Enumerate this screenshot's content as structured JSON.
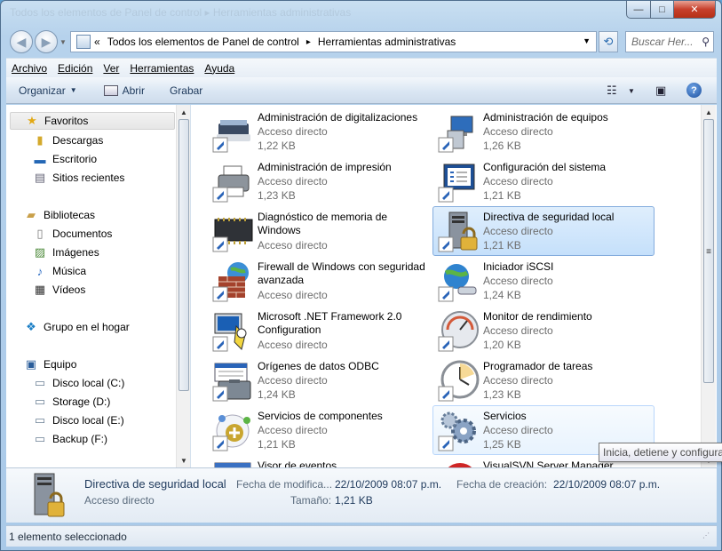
{
  "window": {
    "title": "Todos los elementos de Panel de control ▸ Herramientas administrativas",
    "controls": {
      "minimize": "—",
      "maximize": "□",
      "close": "✕"
    }
  },
  "address": {
    "overflow": "«",
    "crumbs": [
      "Todos los elementos de Panel de control",
      "Herramientas administrativas"
    ],
    "separator": "▸"
  },
  "search": {
    "placeholder": "Buscar Her..."
  },
  "menu": [
    "Archivo",
    "Edición",
    "Ver",
    "Herramientas",
    "Ayuda"
  ],
  "toolbar": {
    "organize": "Organizar",
    "open": "Abrir",
    "burn": "Grabar"
  },
  "nav": {
    "favorites": {
      "label": "Favoritos",
      "items": [
        "Descargas",
        "Escritorio",
        "Sitios recientes"
      ]
    },
    "libraries": {
      "label": "Bibliotecas",
      "items": [
        "Documentos",
        "Imágenes",
        "Música",
        "Vídeos"
      ]
    },
    "homegroup": {
      "label": "Grupo en el hogar"
    },
    "computer": {
      "label": "Equipo",
      "items": [
        "Disco local (C:)",
        "Storage (D:)",
        "Disco local (E:)",
        "Backup (F:)"
      ]
    }
  },
  "files": [
    {
      "name": "Administración de digitalizaciones",
      "type": "Acceso directo",
      "size": "1,22 KB",
      "icon": "scanner-icon"
    },
    {
      "name": "Administración de equipos",
      "type": "Acceso directo",
      "size": "1,26 KB",
      "icon": "computer-management-icon"
    },
    {
      "name": "Administración de impresión",
      "type": "Acceso directo",
      "size": "1,23 KB",
      "icon": "printer-icon"
    },
    {
      "name": "Configuración del sistema",
      "type": "Acceso directo",
      "size": "1,21 KB",
      "icon": "system-config-icon"
    },
    {
      "name": "Diagnóstico de memoria de Windows",
      "type": "Acceso directo",
      "size": "",
      "icon": "memory-chip-icon"
    },
    {
      "name": "Directiva de seguridad local",
      "type": "Acceso directo",
      "size": "1,21 KB",
      "icon": "security-policy-icon"
    },
    {
      "name": "Firewall de Windows con seguridad avanzada",
      "type": "Acceso directo",
      "size": "",
      "icon": "firewall-icon"
    },
    {
      "name": "Iniciador iSCSI",
      "type": "Acceso directo",
      "size": "1,24 KB",
      "icon": "iscsi-icon"
    },
    {
      "name": "Microsoft .NET Framework 2.0 Configuration",
      "type": "Acceso directo",
      "size": "",
      "icon": "dotnet-config-icon"
    },
    {
      "name": "Monitor de rendimiento",
      "type": "Acceso directo",
      "size": "1,20 KB",
      "icon": "performance-gauge-icon"
    },
    {
      "name": "Orígenes de datos ODBC",
      "type": "Acceso directo",
      "size": "1,24 KB",
      "icon": "odbc-icon"
    },
    {
      "name": "Programador de tareas",
      "type": "Acceso directo",
      "size": "1,23 KB",
      "icon": "clock-icon"
    },
    {
      "name": "Servicios de componentes",
      "type": "Acceso directo",
      "size": "1,21 KB",
      "icon": "component-services-icon"
    },
    {
      "name": "Servicios",
      "type": "Acceso directo",
      "size": "1,25 KB",
      "icon": "gears-icon"
    },
    {
      "name": "Visor de eventos",
      "type": "",
      "size": "",
      "icon": "event-viewer-icon"
    },
    {
      "name": "VisualSVN Server Manager",
      "type": "",
      "size": "",
      "icon": "visualsvn-icon"
    }
  ],
  "tooltip": "Inicia, detiene y configura",
  "details": {
    "name": "Directiva de seguridad local",
    "type": "Acceso directo",
    "modified_label": "Fecha de modifica...",
    "modified_value": "22/10/2009 08:07 p.m.",
    "created_label": "Fecha de creación:",
    "created_value": "22/10/2009 08:07 p.m.",
    "size_label": "Tamaño:",
    "size_value": "1,21 KB"
  },
  "status": "1 elemento seleccionado",
  "colors": {
    "selection": "#c5e0fb",
    "selection_border": "#84acdd",
    "secondary_text": "#6d6d6d"
  }
}
